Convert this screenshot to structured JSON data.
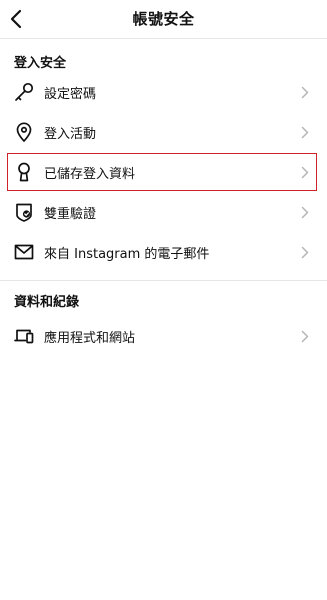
{
  "header": {
    "title": "帳號安全"
  },
  "sections": [
    {
      "title": "登入安全",
      "items": [
        {
          "label": "設定密碼",
          "icon": "key-icon"
        },
        {
          "label": "登入活動",
          "icon": "location-pin-icon"
        },
        {
          "label": "已儲存登入資料",
          "icon": "keyhole-icon",
          "highlighted": true
        },
        {
          "label": "雙重驗證",
          "icon": "shield-check-icon"
        },
        {
          "label": "來自 Instagram 的電子郵件",
          "icon": "envelope-icon"
        }
      ]
    },
    {
      "title": "資料和紀錄",
      "items": [
        {
          "label": "應用程式和網站",
          "icon": "devices-icon"
        }
      ]
    }
  ],
  "colors": {
    "highlight_border": "#d0202a",
    "chevron": "#b5b5b5",
    "divider": "#e6e6e6"
  }
}
